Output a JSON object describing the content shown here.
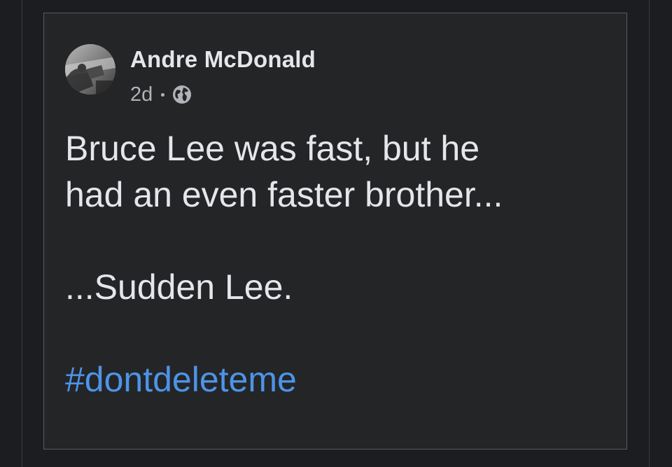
{
  "post": {
    "author": "Andre McDonald",
    "time": "2d",
    "privacy_icon": "globe-icon",
    "lines": [
      "Bruce Lee was fast, but he",
      "had an even faster brother...",
      "...Sudden Lee."
    ],
    "hashtag": "#dontdeleteme"
  },
  "colors": {
    "background": "#1c1d20",
    "card": "#242527",
    "text_primary": "#e4e6eb",
    "text_secondary": "#b0b3b8",
    "link": "#4d94e8"
  }
}
